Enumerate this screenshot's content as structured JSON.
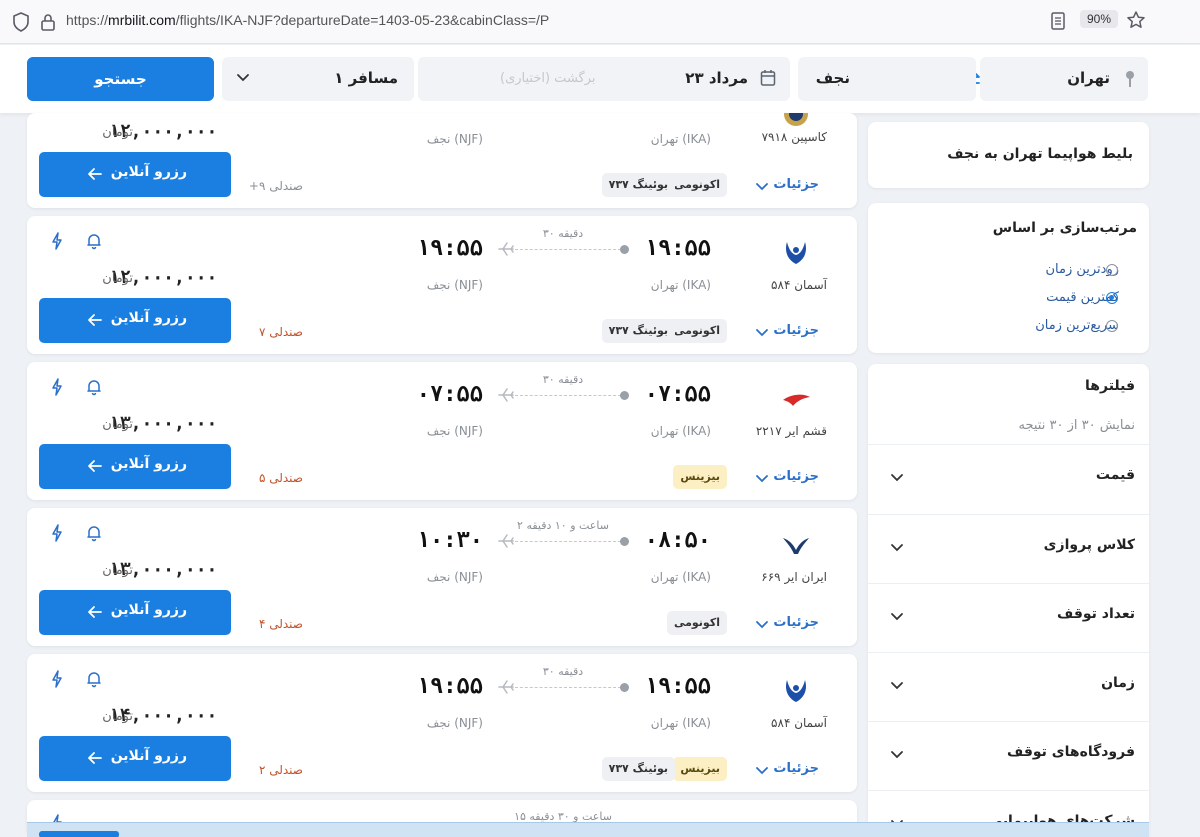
{
  "browser": {
    "url_prefix": "https://",
    "url_host": "mrbilit.com",
    "url_path": "/flights/IKA-NJF?departureDate=1403-05-23&cabinClass=/P",
    "zoom": "90%"
  },
  "search": {
    "origin": "تهران",
    "destination": "نجف",
    "date": "۲۳ مرداد",
    "return_placeholder": "برگشت (اختیاری)",
    "passengers": "۱ مسافر",
    "search_label": "جستجو"
  },
  "sidebar": {
    "title": "بلیط هواپیما تهران به نجف",
    "sort_heading": "مرتب‌سازی بر اساس",
    "sort_options": [
      {
        "label": "زودترین زمان",
        "selected": false
      },
      {
        "label": "کمترین قیمت",
        "selected": true
      },
      {
        "label": "سریع‌ترین زمان",
        "selected": false
      }
    ],
    "filters_heading": "فیلترها",
    "results_count": "نمایش ۳۰ از ۳۰ نتیجه",
    "facets": [
      "قیمت",
      "کلاس پروازی",
      "تعداد توقف",
      "زمان",
      "فرودگاه‌های توقف",
      "شرکت‌های هواپیمایی"
    ]
  },
  "labels": {
    "details": "جزئیات",
    "book": "رزرو آنلاین",
    "currency": "تومان"
  },
  "flights": [
    {
      "airline": "کاسپین ۷۹۱۸",
      "dep_city": "تهران (IKA)",
      "arr_city": "نجف (NJF)",
      "tags": [
        "اکونومی",
        "بوئینگ ۷۳۷"
      ],
      "price": "۱۲,۰۰۰,۰۰۰",
      "seats": "+۹ صندلی"
    },
    {
      "airline": "آسمان ۵۸۴",
      "dep_time": "۱۹:۵۵",
      "arr_time": "۱۹:۵۵",
      "duration": "۳۰ دقیقه",
      "dep_city": "تهران (IKA)",
      "arr_city": "نجف (NJF)",
      "tags": [
        "اکونومی",
        "بوئینگ ۷۳۷"
      ],
      "price": "۱۲,۰۰۰,۰۰۰",
      "seats": "۷ صندلی"
    },
    {
      "airline": "قشم ایر ۲۲۱۷",
      "dep_time": "۰۷:۵۵",
      "arr_time": "۰۷:۵۵",
      "duration": "۳۰ دقیقه",
      "dep_city": "تهران (IKA)",
      "arr_city": "نجف (NJF)",
      "tags": [
        "بیزینس"
      ],
      "price": "۱۳,۰۰۰,۰۰۰",
      "seats": "۵ صندلی"
    },
    {
      "airline": "ایران ایر ۶۶۹",
      "dep_time": "۰۸:۵۰",
      "arr_time": "۱۰:۳۰",
      "duration": "۲ ساعت و ۱۰ دقیقه",
      "dep_city": "تهران (IKA)",
      "arr_city": "نجف (NJF)",
      "tags": [
        "اکونومی"
      ],
      "price": "۱۳,۰۰۰,۰۰۰",
      "seats": "۴ صندلی"
    },
    {
      "airline": "آسمان ۵۸۴",
      "dep_time": "۱۹:۵۵",
      "arr_time": "۱۹:۵۵",
      "duration": "۳۰ دقیقه",
      "dep_city": "تهران (IKA)",
      "arr_city": "نجف (NJF)",
      "tags": [
        "بیزینس",
        "بوئینگ ۷۳۷"
      ],
      "price": "۱۴,۰۰۰,۰۰۰",
      "seats": "۲ صندلی"
    },
    {
      "duration": "۱۵ ساعت و ۳۰ دقیقه"
    }
  ],
  "colors": {
    "primary": "#1a7fe0",
    "seats_warning": "#c0542b",
    "business_tag": "#fcefc4"
  }
}
